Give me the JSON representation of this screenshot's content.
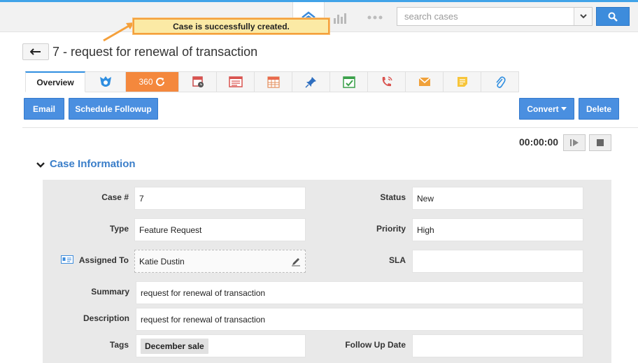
{
  "search": {
    "placeholder": "search cases"
  },
  "toast": {
    "message": "Case is successfully created."
  },
  "header": {
    "title": "7 - request for renewal of transaction"
  },
  "tabs": [
    {
      "label": "Overview",
      "icon": ""
    },
    {
      "label": "",
      "icon": "sales-rep-icon"
    },
    {
      "label": "360",
      "icon": "refresh-icon"
    },
    {
      "label": "",
      "icon": "calendar-clock-icon"
    },
    {
      "label": "",
      "icon": "list-card-icon"
    },
    {
      "label": "",
      "icon": "calendar-icon"
    },
    {
      "label": "",
      "icon": "pin-icon"
    },
    {
      "label": "",
      "icon": "task-check-icon"
    },
    {
      "label": "",
      "icon": "phone-call-icon"
    },
    {
      "label": "",
      "icon": "email-icon"
    },
    {
      "label": "",
      "icon": "note-icon"
    },
    {
      "label": "",
      "icon": "paperclip-icon"
    }
  ],
  "actions": {
    "email": "Email",
    "schedule_followup": "Schedule Followup",
    "convert": "Convert",
    "delete": "Delete"
  },
  "timer": {
    "value": "00:00:00"
  },
  "section": {
    "title": "Case Information"
  },
  "fields": {
    "case_no": {
      "label": "Case #",
      "value": "7"
    },
    "status": {
      "label": "Status",
      "value": "New"
    },
    "type": {
      "label": "Type",
      "value": "Feature Request"
    },
    "priority": {
      "label": "Priority",
      "value": "High"
    },
    "assigned_to": {
      "label": "Assigned To",
      "value": "Katie Dustin"
    },
    "sla": {
      "label": "SLA",
      "value": ""
    },
    "summary": {
      "label": "Summary",
      "value": "request for renewal of transaction"
    },
    "description": {
      "label": "Description",
      "value": "request for renewal of transaction"
    },
    "tags": {
      "label": "Tags",
      "value": "December sale"
    },
    "follow_up_date": {
      "label": "Follow Up Date",
      "value": ""
    }
  },
  "colors": {
    "accent": "#4a8fe0",
    "toast_border": "#f5a03b",
    "toast_bg": "#fbeaa5",
    "tab_orange": "#f4883d",
    "section_title": "#3a7ec9"
  }
}
